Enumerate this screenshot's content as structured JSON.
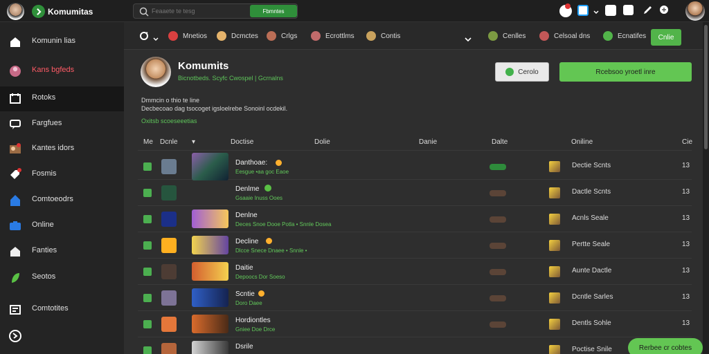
{
  "top": {
    "app_name": "Komumitas",
    "search_placeholder": "Feaaete tе tesg",
    "search_button": "Fbmntes",
    "right_icons": [
      "notification-icon",
      "profile-badge-icon",
      "dropdown-icon",
      "app-icon",
      "square-icon",
      "pen-icon",
      "gamepad-icon"
    ]
  },
  "sidebar": {
    "items": [
      {
        "label": "Komunin lias",
        "icon": "home-icon"
      },
      {
        "label": "Kans bgfeds",
        "icon": "avatar-icon"
      },
      {
        "label": "Rotoks",
        "icon": "calendar-icon"
      },
      {
        "label": "Fargfues",
        "icon": "chat-icon"
      },
      {
        "label": "Kantes idors",
        "icon": "users-icon"
      },
      {
        "label": "Fosmis",
        "icon": "tag-icon"
      },
      {
        "label": "Comtoeodrs",
        "icon": "shield-icon"
      },
      {
        "label": "Online",
        "icon": "briefcase-icon"
      },
      {
        "label": "Fanties",
        "icon": "bookmark-icon"
      },
      {
        "label": "Seotos",
        "icon": "leaf-icon"
      },
      {
        "label": "Comtotites",
        "icon": "grid-icon"
      }
    ],
    "footer_icon": "globe-icon"
  },
  "subnav": {
    "items": [
      {
        "label": "Mnetios"
      },
      {
        "label": "Dcmctes"
      },
      {
        "label": "Crlgs"
      },
      {
        "label": "Ecrottlms"
      },
      {
        "label": "Contis"
      },
      {
        "label": "Cenlles"
      },
      {
        "label": "Celsoal dns"
      },
      {
        "label": "Ecnatifes"
      }
    ],
    "cta": "Cnlie"
  },
  "profile": {
    "title": "Komumits",
    "subtitle": "Bicnotbeds. Scyfc Cwospel | Gcrnalns",
    "desc1": "Dmmcin o thio te line",
    "desc2": "Decbecoao dag tsocoget igsloelrebe Sonoinl ocdekil.",
    "link": "Oxitsb scoeseeetias",
    "btn_outline": "Cerolo",
    "btn_primary": "Rcebsoo yroetl inre"
  },
  "table": {
    "headers": [
      "Me",
      "Dcnle",
      "Doctise",
      "Dolie",
      "Danie",
      "Dalte",
      "Oniline",
      "Cie"
    ],
    "rows": [
      {
        "name": "Danthoae:",
        "sub": "Eesgue  •aa  goc Eaoe",
        "online": "Dectie Scnts",
        "num": "13",
        "tag_green": true
      },
      {
        "name": "Denlme",
        "sub": "Gsaaie  Inuss  Ooes",
        "online": "Dactle Scnts",
        "num": "13"
      },
      {
        "name": "Denlne",
        "sub": "Deces Snoe  Dooe  Potla  •  Snnle Dosea",
        "online": "Acnls Seale",
        "num": "13"
      },
      {
        "name": "Decline",
        "sub": "Dlcce  Snece  Dnaee  •  Snnle  •",
        "online": "Pertte Seale",
        "num": "13"
      },
      {
        "name": "Daitie",
        "sub": "Depoocs  Dor Soeso",
        "online": "Aunte Dactle",
        "num": "13"
      },
      {
        "name": "Scntie",
        "sub": "Doro  Daee",
        "online": "Dcntle Sarles",
        "num": "13"
      },
      {
        "name": "Hordiontles",
        "sub": "Gniee  Doe  Drce",
        "online": "Dentls Sohle",
        "num": "13"
      },
      {
        "name": "Dsrile",
        "sub": "",
        "online": "Poctise Snile",
        "num": ""
      }
    ]
  },
  "floating_button": "Rerbee cr cobtes",
  "colors": {
    "accent_green": "#63c653",
    "brand": "#2f8f3a"
  }
}
